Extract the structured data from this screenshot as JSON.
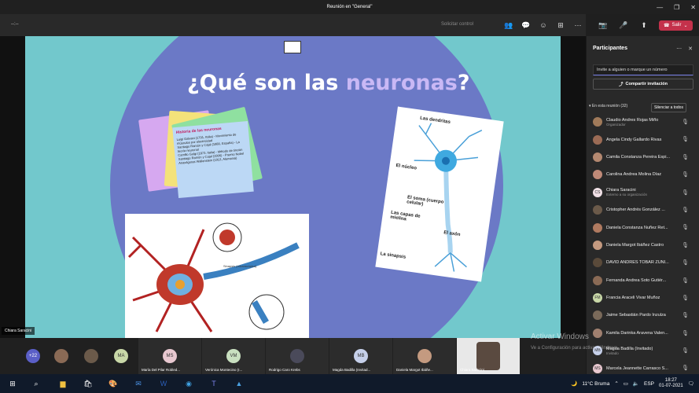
{
  "window": {
    "title": "Reunión en \"General\""
  },
  "meeting": {
    "elapsed": "--:--",
    "request_control": "Solicitar control",
    "leave_label": "Salir",
    "sharer_name": "Chiara Saracini"
  },
  "slide": {
    "title_start": "¿Qué son las ",
    "title_highlight": "neuronas",
    "title_end": "?",
    "notes_heading": "Historia de las neuronas",
    "notes_lines": [
      "Luigi Galvani (1791, Italia) - Movimiento de músculos por electricidad",
      "Santiago Ramón y Cajal (1888, España) - La teoría neuronal",
      "Camillo Golgi (1873, Italia) - Método de tinción",
      "Santiago Ramón y Cajal (1906) - Premio Nobel",
      "Anaxágoras Wallenstein (1913, Alemania)"
    ],
    "neuron_labels": {
      "dendrites": "Las dendritas",
      "nucleus": "El núcleo",
      "soma": "El soma (cuerpo celular)",
      "myelin": "Las capas de mielina",
      "axon": "El axón",
      "synapse": "La sinapsis"
    },
    "diagram_labels": {
      "vm": "Vesícula sináptica",
      "synapse": "Sinapsis (microscópica)"
    }
  },
  "panel": {
    "title": "Participantes",
    "invite_placeholder": "Invite a alguien o marque un número",
    "share_invite": "Compartir invitación",
    "in_meeting": "En esta reunión (32)",
    "silence_all": "Silenciar a todos",
    "participants": [
      {
        "name": "Claudio Andres Rojas Miño",
        "role": "Organizador",
        "color": "#a07a5a",
        "initials": ""
      },
      {
        "name": "Angela Cindy Gallardo Rivas",
        "role": "",
        "color": "#9b6b55",
        "initials": ""
      },
      {
        "name": "Camila Constanza Pereira Espi...",
        "role": "",
        "color": "#b48870",
        "initials": ""
      },
      {
        "name": "Carolina Andrea Molina Díaz",
        "role": "",
        "color": "#c08a78",
        "initials": ""
      },
      {
        "name": "Chiara Saracini",
        "role": "Externo a su organización",
        "color": "#f0e0e6",
        "initials": "CS"
      },
      {
        "name": "Cristopher Andrés González ...",
        "role": "",
        "color": "#6b5a4a",
        "initials": ""
      },
      {
        "name": "Daniela Constanza Nuñez Ret...",
        "role": "",
        "color": "#b07a60",
        "initials": ""
      },
      {
        "name": "Daniela Margot Ibáñez Castro",
        "role": "",
        "color": "#c49a80",
        "initials": ""
      },
      {
        "name": "DAVID ANDRÉS TOBAR ZÚÑI...",
        "role": "",
        "color": "#5a4a3a",
        "initials": ""
      },
      {
        "name": "Fernanda Andrea Soto Gutiér...",
        "role": "",
        "color": "#8a6a55",
        "initials": ""
      },
      {
        "name": "Francia Araceli Vivar Muñoz",
        "role": "",
        "color": "#c9d8a8",
        "initials": "FM"
      },
      {
        "name": "Jaime Sebastián Pardo Inzulza",
        "role": "",
        "color": "#7a6a5a",
        "initials": ""
      },
      {
        "name": "Kamila Darinka Aravena Valen...",
        "role": "",
        "color": "#a08070",
        "initials": ""
      },
      {
        "name": "Magda Badilla (Invitado)",
        "role": "Invitado",
        "color": "#c6d0ea",
        "initials": "MB"
      },
      {
        "name": "Marcela Jeannette Carrasco S...",
        "role": "",
        "color": "#e8c8d0",
        "initials": "MS"
      }
    ]
  },
  "gallery": {
    "overflow_count": "+22",
    "tiles": [
      {
        "initials": "",
        "name": "",
        "color": "#8a6a55"
      },
      {
        "initials": "",
        "name": "",
        "color": "#6b5a4a"
      },
      {
        "initials": "MA",
        "name": "",
        "color": "#c9d8a8"
      },
      {
        "initials": "MS",
        "name": "María Del Pilar Robled...",
        "color": "#e8c8d0"
      },
      {
        "initials": "VM",
        "name": "Verónica Montecino (I...",
        "color": "#c9e0c0"
      },
      {
        "initials": "",
        "name": "Rodrigo Caro Krebs",
        "color": "#4a4a5a"
      },
      {
        "initials": "MB",
        "name": "Magda Badilla (Invitad...",
        "color": "#c6d0ea"
      },
      {
        "initials": "",
        "name": "Daniela Margot Ibáñe...",
        "color": "#c49a80"
      },
      {
        "initials": "",
        "name": "Chiara Saracini",
        "color": "#5a4a40"
      }
    ]
  },
  "watermark": {
    "line1": "Activar Windows",
    "line2": "Ve a Configuración para activar Windows."
  },
  "taskbar": {
    "weather": "11°C Bruma",
    "lang": "ESP",
    "time": "18:27",
    "date": "01-07-2021"
  }
}
